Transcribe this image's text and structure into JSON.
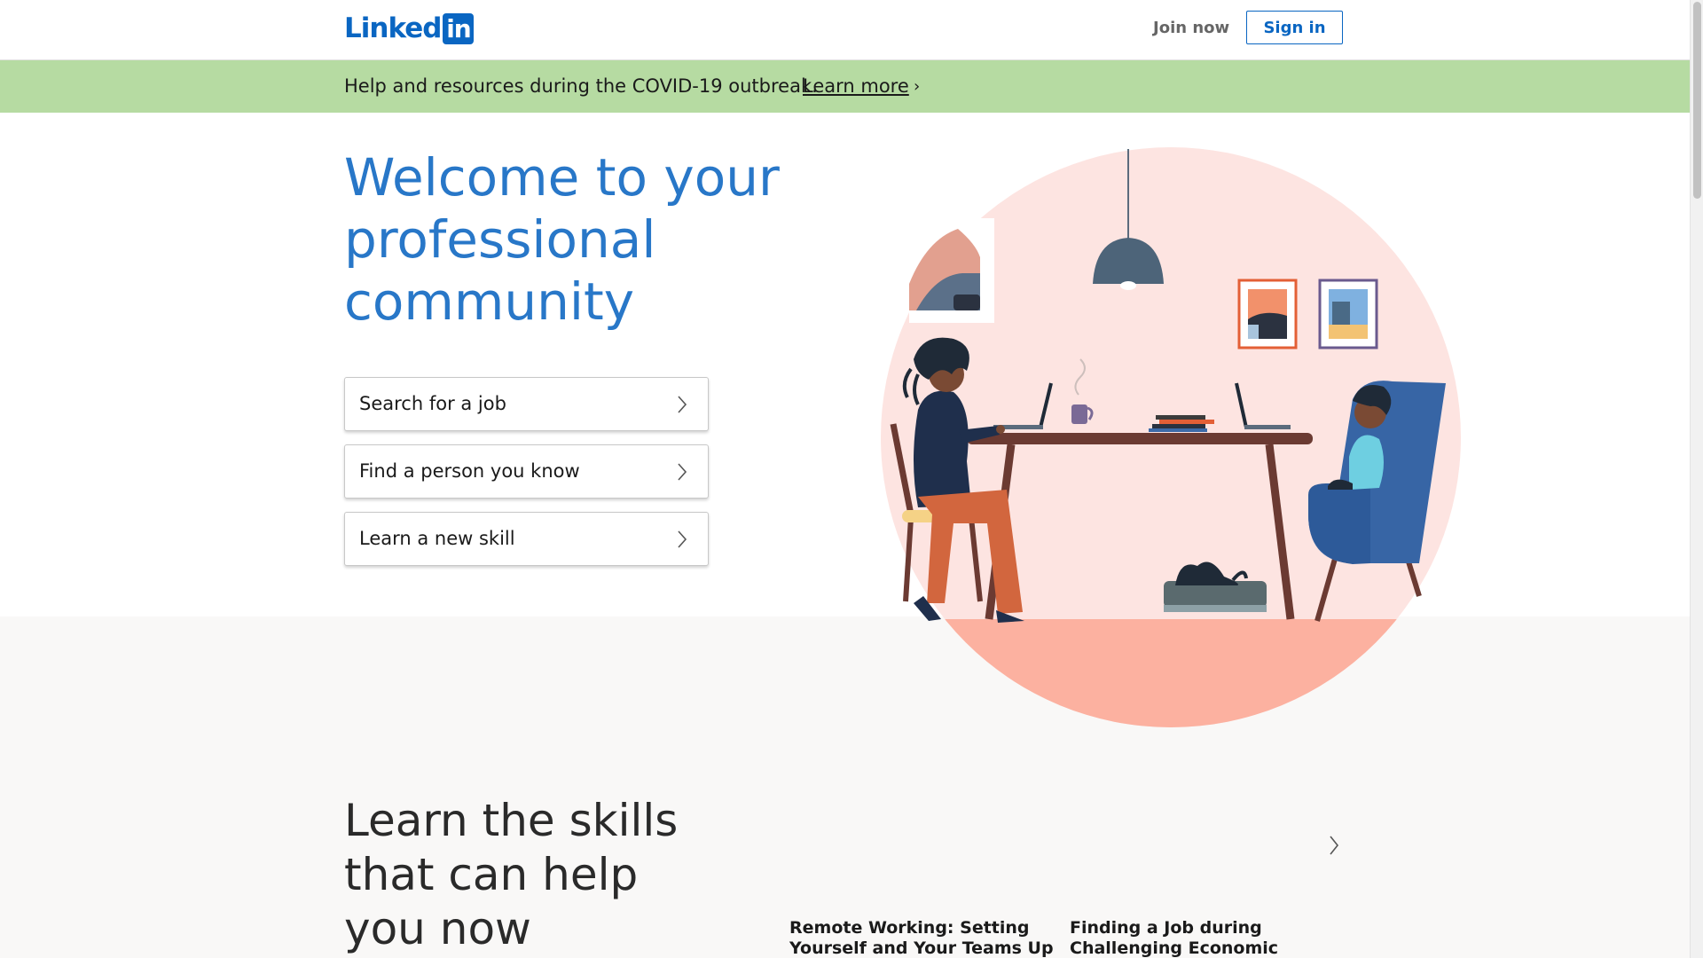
{
  "header": {
    "logo_text": "Linked",
    "logo_box_text": "in",
    "join_label": "Join now",
    "signin_label": "Sign in"
  },
  "banner": {
    "text": "Help and resources during the COVID-19 outbreak.",
    "link_label": "Learn more",
    "chevron_icon": "chevron-right-icon"
  },
  "hero": {
    "title": "Welcome to your professional community",
    "actions": [
      {
        "label": "Search for a job",
        "icon": "chevron-right-icon"
      },
      {
        "label": "Find a person you know",
        "icon": "chevron-right-icon"
      },
      {
        "label": "Learn a new skill",
        "icon": "chevron-right-icon"
      }
    ]
  },
  "learn": {
    "title": "Learn the skills that can help you now",
    "courses": [
      {
        "title": "Remote Working: Setting Yourself and Your Teams Up"
      },
      {
        "title": "Finding a Job during Challenging Economic"
      }
    ],
    "next_icon": "chevron-right-icon"
  },
  "colors": {
    "brand": "#0a66c2",
    "hero_title": "#2877c8",
    "banner_bg": "#b6dba2",
    "illustration_bg": "#fde4e1",
    "floor": "#fcb1a0"
  }
}
